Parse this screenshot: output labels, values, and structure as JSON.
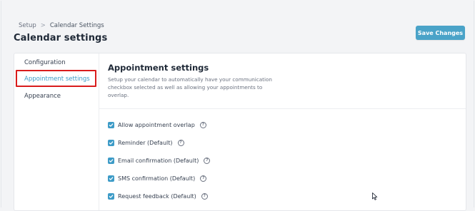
{
  "breadcrumb": {
    "items": [
      "Setup",
      "Calendar Settings"
    ],
    "separator": ">"
  },
  "page": {
    "title": "Calendar settings"
  },
  "header": {
    "save_label": "Save Changes"
  },
  "sidebar": {
    "items": [
      {
        "label": "Configuration",
        "active": false
      },
      {
        "label": "Appointment settings",
        "active": true
      },
      {
        "label": "Appearance",
        "active": false
      }
    ]
  },
  "section": {
    "title": "Appointment settings",
    "description": "Setup your calendar to automatically have your communication checkbox selected as well as allowing your appointments to overlap."
  },
  "options": [
    {
      "label": "Allow appointment overlap",
      "checked": true,
      "help_icon": "question-circle-icon"
    },
    {
      "label": "Reminder (Default)",
      "checked": true,
      "help_icon": "question-circle-icon"
    },
    {
      "label": "Email confirmation (Default)",
      "checked": true,
      "help_icon": "question-circle-icon"
    },
    {
      "label": "SMS confirmation (Default)",
      "checked": true,
      "help_icon": "question-circle-icon"
    },
    {
      "label": "Request feedback (Default)",
      "checked": true,
      "help_icon": "question-circle-icon"
    }
  ],
  "colors": {
    "accent": "#3d9bc7",
    "save_button": "#4aa3c8",
    "highlight_box": "#d91c1c"
  }
}
